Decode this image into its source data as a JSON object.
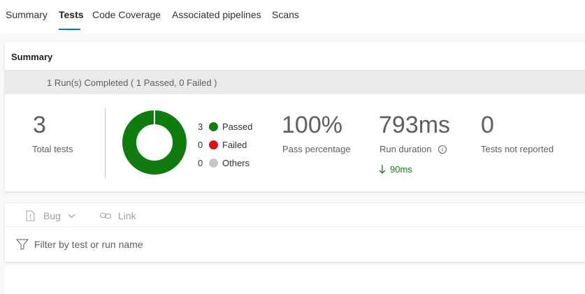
{
  "tabs": [
    {
      "label": "Summary"
    },
    {
      "label": "Tests"
    },
    {
      "label": "Code Coverage"
    },
    {
      "label": "Associated pipelines"
    },
    {
      "label": "Scans"
    }
  ],
  "summary": {
    "heading": "Summary",
    "run_status": "1 Run(s) Completed ( 1 Passed, 0 Failed )",
    "total_tests": {
      "value": "3",
      "label": "Total tests"
    },
    "legend": [
      {
        "count": "3",
        "label": "Passed",
        "color": "#107c10"
      },
      {
        "count": "0",
        "label": "Failed",
        "color": "#e00b1c"
      },
      {
        "count": "0",
        "label": "Others",
        "color": "#c8c6c4"
      }
    ],
    "pass_percentage": {
      "value": "100%",
      "label": "Pass percentage"
    },
    "run_duration": {
      "value": "793ms",
      "label": "Run duration",
      "delta": "90ms"
    },
    "not_reported": {
      "value": "0",
      "label": "Tests not reported"
    }
  },
  "toolbar": {
    "bug_label": "Bug",
    "link_label": "Link"
  },
  "filter": {
    "placeholder": "Filter by test or run name"
  },
  "colors": {
    "accent": "#0078d4",
    "passed": "#107c10",
    "failed": "#e00b1c",
    "others": "#c8c6c4"
  }
}
